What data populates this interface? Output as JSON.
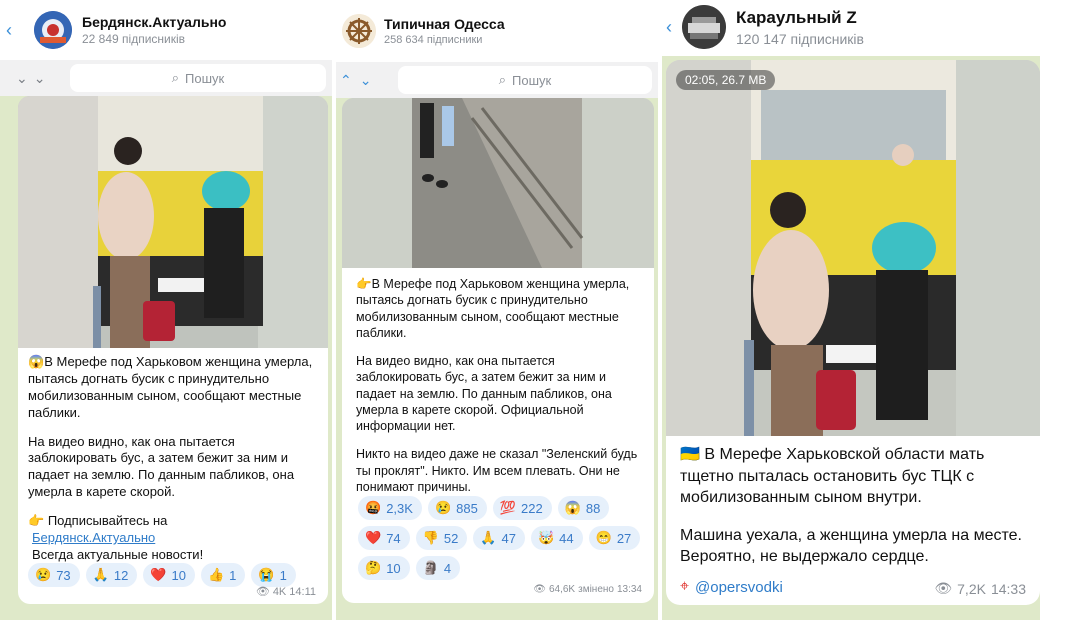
{
  "panel1": {
    "channel_name": "Бердянск.Актуально",
    "subscribers": "22 849 підписників",
    "search_placeholder": "Пошук",
    "text_p1": "В Мерефе под Харьковом женщина умерла, пытаясь догнать бусик с принудительно мобилизованным сыном, сообщают местные паблики.",
    "text_p2": "На видео видно, как она пытается заблокировать бус, а затем бежит за ним и падает на землю. По данным пабликов, она умерла в карете скорой.",
    "subscribe_text": "Подписывайтесь на",
    "subscribe_link": "Бердянск.Актуально",
    "subscribe_tail": "Всегда актуальные новости!",
    "reactions": [
      {
        "emoji": "😢",
        "count": "73"
      },
      {
        "emoji": "🙏",
        "count": "12"
      },
      {
        "emoji": "❤️",
        "count": "10"
      },
      {
        "emoji": "👍",
        "count": "1"
      },
      {
        "emoji": "😭",
        "count": "1"
      }
    ],
    "views": "4K",
    "time": "14:11"
  },
  "panel2": {
    "channel_name": "Типичная Одесса",
    "subscribers": "258 634 підписники",
    "search_placeholder": "Пошук",
    "text_p1": "В Мерефе под Харьковом женщина умерла, пытаясь догнать бусик с принудительно мобилизованным сыном, сообщают местные паблики.",
    "text_p2": "На видео видно, как она пытается заблокировать бус, а затем бежит за ним и падает на землю. По данным пабликов, она умерла в карете скорой. Официальной информации нет.",
    "text_p3": "Никто на видео даже не сказал \"Зеленский будь ты проклят\". Никто. Им всем плевать. Они не понимают причины.",
    "reactions": [
      {
        "emoji": "🤬",
        "count": "2,3K"
      },
      {
        "emoji": "😢",
        "count": "885"
      },
      {
        "emoji": "💯",
        "count": "222"
      },
      {
        "emoji": "😱",
        "count": "88"
      },
      {
        "emoji": "❤️",
        "count": "74"
      },
      {
        "emoji": "👎",
        "count": "52"
      },
      {
        "emoji": "🙏",
        "count": "47"
      },
      {
        "emoji": "🤯",
        "count": "44"
      },
      {
        "emoji": "😁",
        "count": "27"
      },
      {
        "emoji": "🤔",
        "count": "10"
      },
      {
        "emoji": "🗿",
        "count": "4"
      }
    ],
    "views": "64,6K",
    "edited": "змінено",
    "time": "13:34"
  },
  "panel3": {
    "channel_name": "Караульный Z",
    "subscribers": "120 147 підписників",
    "video_info": "02:05, 26.7 MB",
    "text_p1": "В Мерефе Харьковской области мать тщетно пыталась остановить бус ТЦК с мобилизованным сыном внутри.",
    "text_p2": "Машина уехала, а женщина умерла на месте. Вероятно, не выдержало сердце.",
    "signature": "@opersvodki",
    "views": "7,2K",
    "time": "14:33"
  }
}
